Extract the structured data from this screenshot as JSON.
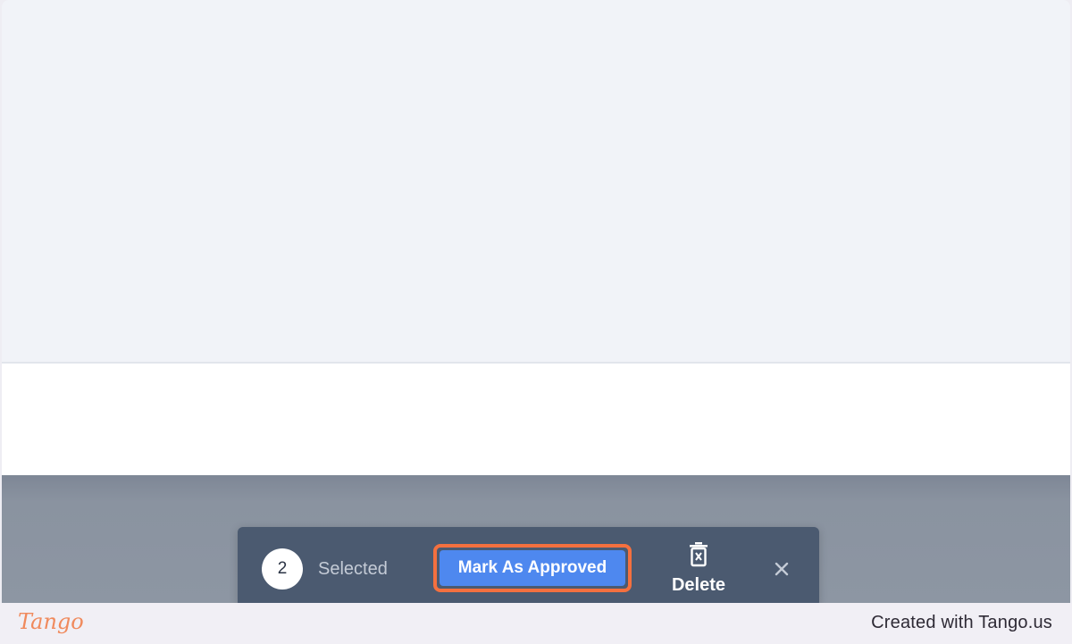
{
  "selection": {
    "count": "2",
    "label": "Selected"
  },
  "actions": {
    "approve_label": "Mark As Approved",
    "delete_label": "Delete",
    "delete_icon": "trash-icon",
    "close_icon": "close-icon"
  },
  "footer": {
    "brand": "Tango",
    "credit": "Created with Tango.us"
  },
  "colors": {
    "accent": "#4e88ef",
    "highlight": "#f4703f",
    "bar": "#4b5a70",
    "brand": "#f08a5d"
  }
}
